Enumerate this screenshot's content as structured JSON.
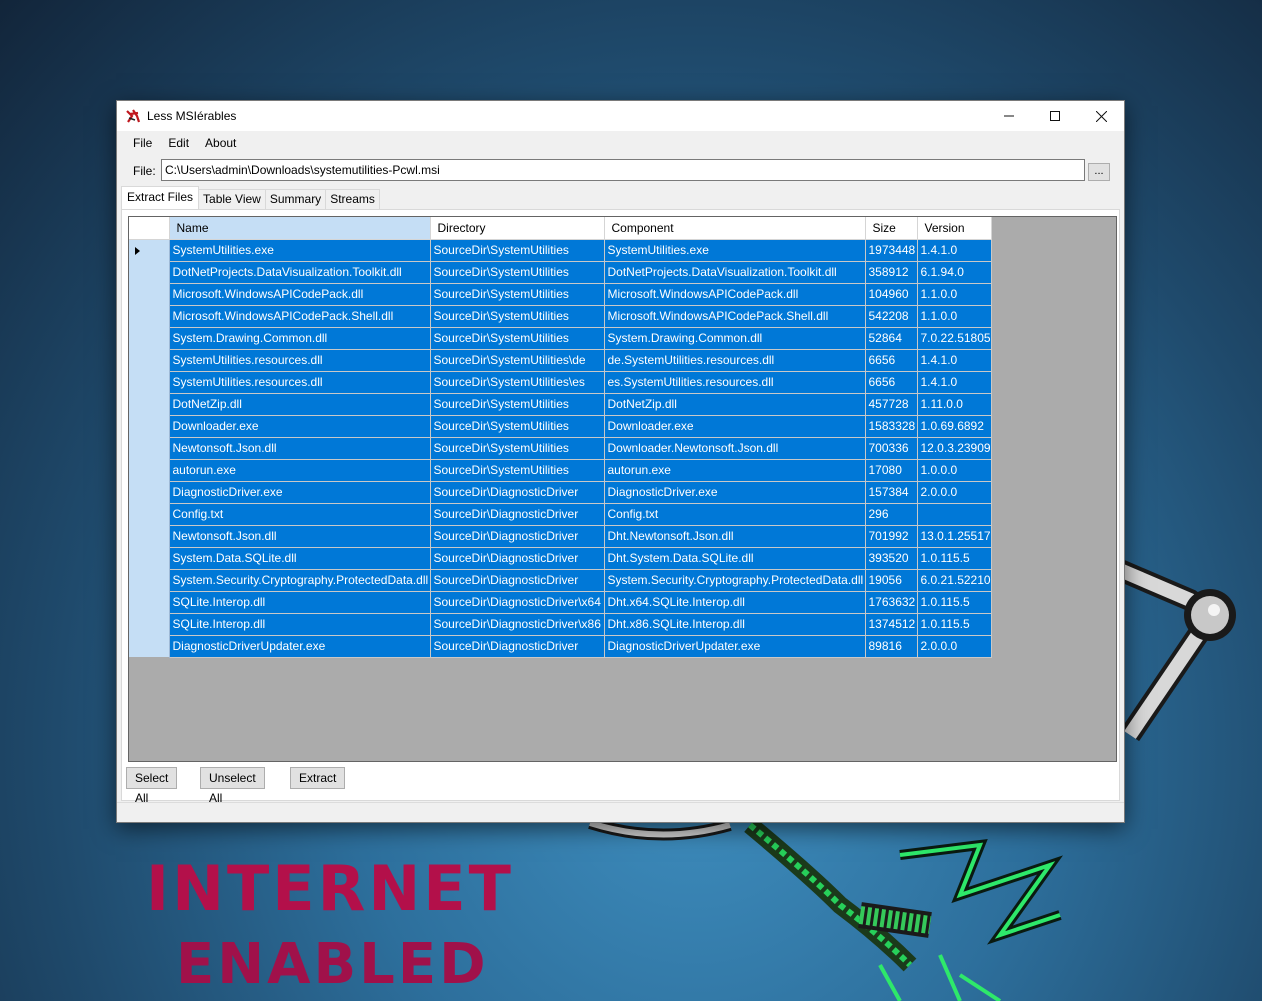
{
  "window": {
    "title": "Less MSIérables",
    "minimize": "—",
    "maximize": "☐",
    "close": "✕"
  },
  "menu": [
    "File",
    "Edit",
    "About"
  ],
  "file_row": {
    "label": "File:",
    "path": "C:\\Users\\admin\\Downloads\\systemutilities-Pcwl.msi",
    "browse_label": "..."
  },
  "tabs": [
    "Extract Files",
    "Table View",
    "Summary",
    "Streams"
  ],
  "active_tab": "Extract Files",
  "table": {
    "columns": [
      "Name",
      "Directory",
      "Component",
      "Size",
      "Version"
    ],
    "rows": [
      [
        "SystemUtilities.exe",
        "SourceDir\\SystemUtilities",
        "SystemUtilities.exe",
        "1973448",
        "1.4.1.0"
      ],
      [
        "DotNetProjects.DataVisualization.Toolkit.dll",
        "SourceDir\\SystemUtilities",
        "DotNetProjects.DataVisualization.Toolkit.dll",
        "358912",
        "6.1.94.0"
      ],
      [
        "Microsoft.WindowsAPICodePack.dll",
        "SourceDir\\SystemUtilities",
        "Microsoft.WindowsAPICodePack.dll",
        "104960",
        "1.1.0.0"
      ],
      [
        "Microsoft.WindowsAPICodePack.Shell.dll",
        "SourceDir\\SystemUtilities",
        "Microsoft.WindowsAPICodePack.Shell.dll",
        "542208",
        "1.1.0.0"
      ],
      [
        "System.Drawing.Common.dll",
        "SourceDir\\SystemUtilities",
        "System.Drawing.Common.dll",
        "52864",
        "7.0.22.51805"
      ],
      [
        "SystemUtilities.resources.dll",
        "SourceDir\\SystemUtilities\\de",
        "de.SystemUtilities.resources.dll",
        "6656",
        "1.4.1.0"
      ],
      [
        "SystemUtilities.resources.dll",
        "SourceDir\\SystemUtilities\\es",
        "es.SystemUtilities.resources.dll",
        "6656",
        "1.4.1.0"
      ],
      [
        "DotNetZip.dll",
        "SourceDir\\SystemUtilities",
        "DotNetZip.dll",
        "457728",
        "1.11.0.0"
      ],
      [
        "Downloader.exe",
        "SourceDir\\SystemUtilities",
        "Downloader.exe",
        "1583328",
        "1.0.69.6892"
      ],
      [
        "Newtonsoft.Json.dll",
        "SourceDir\\SystemUtilities",
        "Downloader.Newtonsoft.Json.dll",
        "700336",
        "12.0.3.23909"
      ],
      [
        "autorun.exe",
        "SourceDir\\SystemUtilities",
        "autorun.exe",
        "17080",
        "1.0.0.0"
      ],
      [
        "DiagnosticDriver.exe",
        "SourceDir\\DiagnosticDriver",
        "DiagnosticDriver.exe",
        "157384",
        "2.0.0.0"
      ],
      [
        "Config.txt",
        "SourceDir\\DiagnosticDriver",
        "Config.txt",
        "296",
        ""
      ],
      [
        "Newtonsoft.Json.dll",
        "SourceDir\\DiagnosticDriver",
        "Dht.Newtonsoft.Json.dll",
        "701992",
        "13.0.1.25517"
      ],
      [
        "System.Data.SQLite.dll",
        "SourceDir\\DiagnosticDriver",
        "Dht.System.Data.SQLite.dll",
        "393520",
        "1.0.115.5"
      ],
      [
        "System.Security.Cryptography.ProtectedData.dll",
        "SourceDir\\DiagnosticDriver",
        "System.Security.Cryptography.ProtectedData.dll",
        "19056",
        "6.0.21.52210"
      ],
      [
        "SQLite.Interop.dll",
        "SourceDir\\DiagnosticDriver\\x64",
        "Dht.x64.SQLite.Interop.dll",
        "1763632",
        "1.0.115.5"
      ],
      [
        "SQLite.Interop.dll",
        "SourceDir\\DiagnosticDriver\\x86",
        "Dht.x86.SQLite.Interop.dll",
        "1374512",
        "1.0.115.5"
      ],
      [
        "DiagnosticDriverUpdater.exe",
        "SourceDir\\DiagnosticDriver",
        "DiagnosticDriverUpdater.exe",
        "89816",
        "2.0.0.0"
      ]
    ]
  },
  "buttons": {
    "select_all": "Select All",
    "unselect_all": "Unselect All",
    "extract": "Extract"
  },
  "wallpaper": {
    "line1": "INTERNET",
    "line2": "ENABLED"
  },
  "colors": {
    "selection": "#0078d7",
    "row_header": "#c5def5",
    "grid_background": "#ababab"
  }
}
